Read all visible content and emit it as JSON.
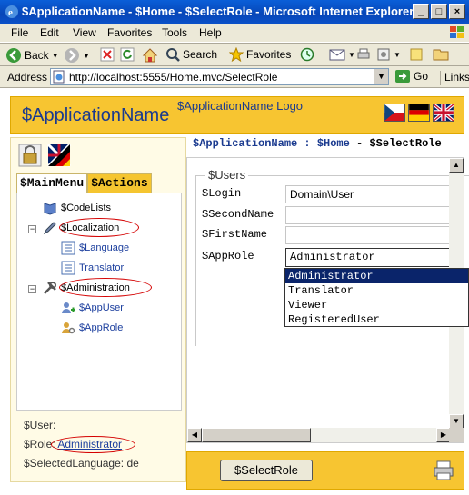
{
  "window": {
    "title": "$ApplicationName - $Home - $SelectRole - Microsoft Internet Explorer"
  },
  "menu": [
    "File",
    "Edit",
    "View",
    "Favorites",
    "Tools",
    "Help"
  ],
  "toolbar": {
    "back": "Back",
    "search": "Search",
    "favorites": "Favorites"
  },
  "address": {
    "label": "Address",
    "url": "http://localhost:5555/Home.mvc/SelectRole",
    "go": "Go",
    "links": "Links"
  },
  "header": {
    "app_name": "$ApplicationName",
    "logo": "$ApplicationName Logo"
  },
  "tabs": {
    "main_menu": "$MainMenu",
    "actions": "$Actions"
  },
  "tree": {
    "code_lists": "$CodeLists",
    "localization": "$Localization",
    "language": "$Language",
    "translator": "Translator",
    "administration": "$Administration",
    "app_user": "$AppUser",
    "app_role": "$AppRole"
  },
  "user_info": {
    "user_label": "$User:",
    "role_label": "$Role:",
    "role_value": "Administrator",
    "language_label": "$SelectedLanguage:",
    "language_value": "de"
  },
  "breadcrumb": {
    "app": "$ApplicationName",
    "sep1": ":",
    "home": "$Home",
    "sep2": "-",
    "current": "$SelectRole"
  },
  "form": {
    "legend": "$Users",
    "login_label": "$Login",
    "login_value": "Domain\\User",
    "second_name_label": "$SecondName",
    "second_name_value": "",
    "first_name_label": "$FirstName",
    "first_name_value": "",
    "app_role_label": "$AppRole",
    "app_role_value": "Administrator",
    "role_options": [
      "Administrator",
      "Translator",
      "Viewer",
      "RegisteredUser"
    ]
  },
  "footer": {
    "select_role_button": "$SelectRole"
  }
}
